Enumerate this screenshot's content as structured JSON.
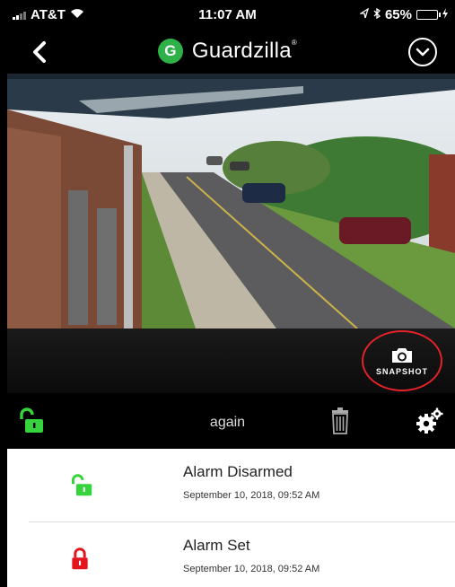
{
  "status_bar": {
    "carrier": "AT&T",
    "time": "11:07 AM",
    "battery": "65%",
    "battery_level": 0.65
  },
  "header": {
    "logo_letter": "G",
    "app_name": "Guardzilla",
    "trademark": "®"
  },
  "snapshot": {
    "label": "SNAPSHOT"
  },
  "controls": {
    "camera_name": "again"
  },
  "events": [
    {
      "title": "Alarm Disarmed",
      "time": "September 10, 2018, 09:52 AM",
      "icon": "unlocked-icon",
      "color": "#35d43c"
    },
    {
      "title": "Alarm Set",
      "time": "September 10, 2018, 09:52 AM",
      "icon": "locked-icon",
      "color": "#e3141d"
    }
  ],
  "colors": {
    "accent_green": "#35d43c",
    "alert_red": "#e3141d"
  }
}
